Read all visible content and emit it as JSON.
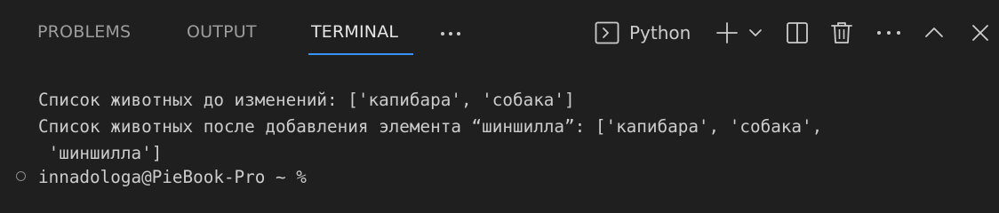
{
  "tabs": [
    {
      "label": "PROBLEMS",
      "active": false
    },
    {
      "label": "OUTPUT",
      "active": false
    },
    {
      "label": "TERMINAL",
      "active": true
    }
  ],
  "more_tabs_icon": "ellipsis-icon",
  "toolbar": {
    "terminal_profile_label": "Python",
    "terminal_profile_icon": "terminal-icon",
    "new_terminal_icon": "plus-icon",
    "profile_dropdown_icon": "chevron-down-icon",
    "split_icon": "split-terminal-icon",
    "kill_icon": "trash-icon",
    "more_icon": "ellipsis-icon",
    "maximize_icon": "chevron-up-icon",
    "close_icon": "close-icon"
  },
  "terminal": {
    "lines": [
      "Список животных до изменений: ['капибара', 'собака']",
      "Список животных после добавления элемента “шиншилла”: ['капибара', 'собака',",
      " 'шиншилла']"
    ],
    "prompt": "innadologa@PieBook-Pro ~ %"
  },
  "colors": {
    "background": "#1f1f1f",
    "active_tab_underline": "#3794ff",
    "text": "#cccccc",
    "inactive_tab_text": "#9d9d9d"
  }
}
